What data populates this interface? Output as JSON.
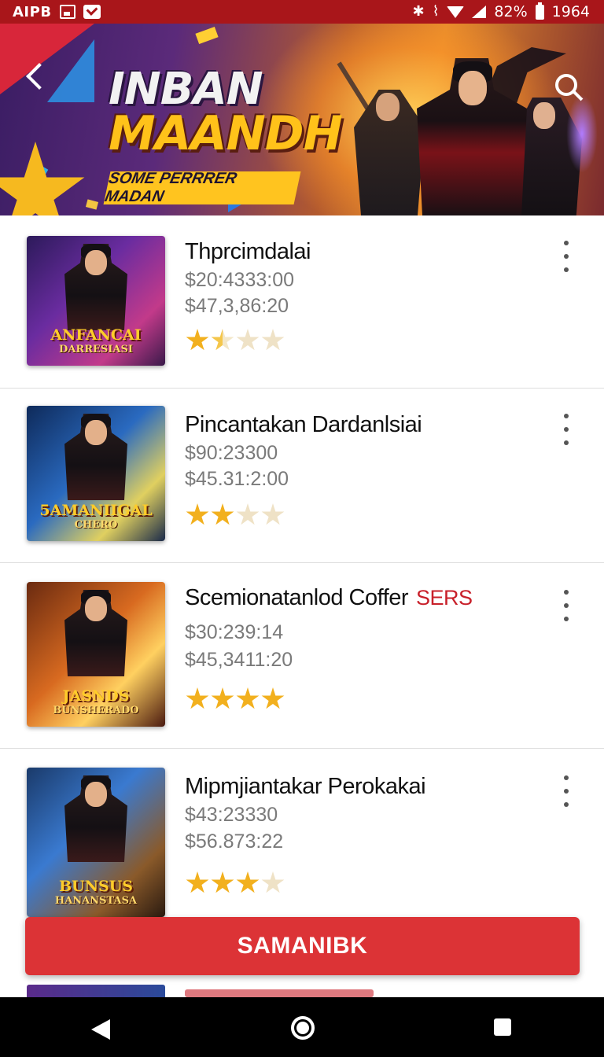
{
  "status_bar": {
    "carrier": "AIPB",
    "right_text": "ᛒ ⚡ ▾ ◢ ↗ 82% 1964",
    "battery_percent": "82%",
    "time": "1964",
    "icons": [
      "image-icon",
      "mail-icon",
      "bluetooth-icon",
      "vibrate-icon",
      "wifi-icon",
      "signal-icon",
      "battery-icon"
    ]
  },
  "banner": {
    "title_line1": "INBAN",
    "title_line2": "MAANDH",
    "ribbon": "SOME PERRRER MADAN",
    "icons": [
      "back-arrow-icon",
      "search-icon"
    ]
  },
  "items": [
    {
      "title": "Thprcimdalai",
      "tag": "",
      "price1": "$20:4333:00",
      "price2": "$47,3,86:20",
      "rating": 1.5,
      "thumb_caption": "ANFANCAI",
      "thumb_subcaption": "DARRESIASI",
      "thumb_bg": "linear-gradient(135deg,#2c1a5a 0%,#6a2ca0 40%,#c23a8a 75%,#3a1a4a 100%)"
    },
    {
      "title": "Pincantakan Dardanlsiai",
      "tag": "",
      "price1": "$90:23300",
      "price2": "$45.31:2:00",
      "rating": 2,
      "thumb_caption": "5AMANIIGAL",
      "thumb_subcaption": "CHERO",
      "thumb_bg": "linear-gradient(135deg,#0e2a5a 0%,#2a6ac0 45%,#e0d060 75%,#1a2a4a 100%)"
    },
    {
      "title": "Scemionatanlod Coffer",
      "tag": "SERS",
      "price1": "$30:239:14",
      "price2": "$45,3411:20",
      "rating": 4,
      "thumb_caption": "JASNDS",
      "thumb_subcaption": "BUNSHERADO",
      "thumb_bg": "linear-gradient(135deg,#6a2a10 0%,#d86a20 45%,#ffd060 70%,#4a1a10 100%)"
    },
    {
      "title": "Mipmjiantakar Perokakai",
      "tag": "",
      "price1": "$43:23330",
      "price2": "$56.873:22",
      "rating": 3,
      "thumb_caption": "BUNSUS",
      "thumb_subcaption": "HANANSTASA",
      "thumb_bg": "linear-gradient(135deg,#1a3a6a 0%,#3a7ad0 40%,#8a5a2a 75%,#2a1a10 100%)"
    }
  ],
  "cta": {
    "label": "SAMANIBK"
  },
  "nav": {
    "icons": [
      "back-triangle-icon",
      "home-circle-icon",
      "recent-square-icon"
    ]
  }
}
